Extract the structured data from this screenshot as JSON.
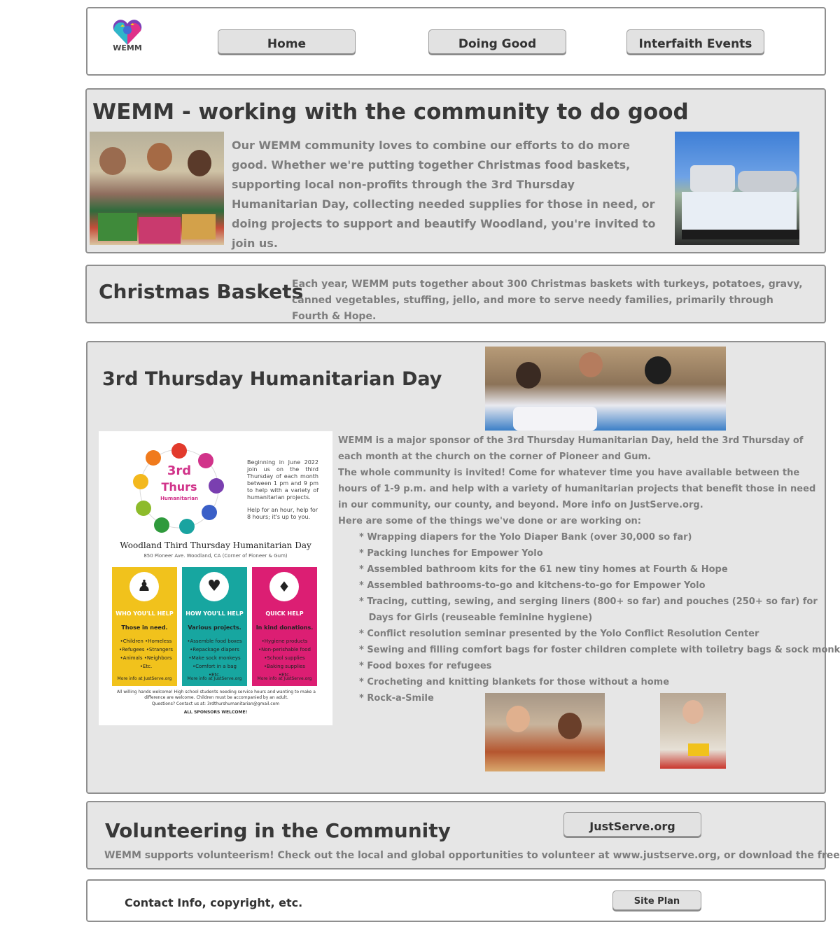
{
  "header": {
    "logo_text": "WEMM",
    "nav": [
      {
        "label": "Home"
      },
      {
        "label": "Doing Good"
      },
      {
        "label": "Interfaith Events"
      }
    ]
  },
  "intro": {
    "title": "WEMM - working with the community to do good",
    "body": "Our WEMM community loves to combine our efforts to do more good. Whether we're putting together Christmas food baskets, supporting local non-profits through the 3rd Thursday Humanitarian Day, collecting needed supplies for those in need, or doing projects to support and beautify Woodland, you're invited to join us."
  },
  "christmas": {
    "title": "Christmas Baskets",
    "body": "Each year, WEMM puts together about 300 Christmas baskets with turkeys, potatoes, gravy, canned vegetables, stuffing, jello, and more to serve needy families, primarily through Fourth & Hope."
  },
  "thursday": {
    "title": "3rd Thursday Humanitarian Day",
    "p1": "WEMM is a major sponsor of the 3rd Thursday Humanitarian Day, held the 3rd Thursday of each month at the church on the corner of Pioneer and Gum.",
    "p2": "The whole community is invited! Come for whatever time you have available between the hours of 1-9 p.m. and help with a variety of humanitarian projects that benefit those in need in our community, our county, and beyond. More info on JustServe.org.",
    "p3": "Here are some of the things we've done or are working on:",
    "items": [
      "* Wrapping diapers for the Yolo Diaper Bank (over 30,000 so far)",
      "* Packing lunches for Empower Yolo",
      "* Assembled bathroom kits for the 61 new tiny homes at Fourth & Hope",
      "* Assembled bathrooms-to-go and kitchens-to-go for Empower Yolo",
      "* Tracing, cutting, sewing, and serging liners (800+ so far) and pouches (250+ so far) for",
      "   Days for Girls (reuseable feminine hygiene)",
      "* Conflict resolution seminar presented by the Yolo Conflict Resolution Center",
      "* Sewing and filling comfort bags for foster children complete with toiletry bags & sock monkeys",
      "* Food boxes for refugees",
      "* Crocheting and knitting blankets for those without a home",
      "* Rock-a-Smile"
    ],
    "flyer": {
      "badge_top": "3rd",
      "badge_mid": "Thurs",
      "badge_arc": "Humanitarian",
      "intro": "Beginning in June 2022 join us on the third Thursday of each month between 1 pm and 9 pm to help with a variety of humanitarian projects.",
      "intro2": "Help for an hour, help for 8 hours; it's up to you.",
      "title": "Woodland Third Thursday Humanitarian Day",
      "address": "850 Pioneer Ave. Woodland, CA (Corner of Pioneer & Gum)",
      "cards": [
        {
          "heading": "WHO YOU'LL HELP",
          "sub": "Those in need.",
          "lines": [
            "•Children   •Homeless",
            "•Refugees   •Strangers",
            "•Animals   •Neighbors",
            "•Etc."
          ],
          "more": "More info at JustServe.org",
          "color": "#f1c21c"
        },
        {
          "heading": "HOW YOU'LL HELP",
          "sub": "Various projects.",
          "lines": [
            "•Assemble food boxes",
            "•Repackage diapers",
            "•Make sock monkeys",
            "•Comfort in a bag",
            "•Etc."
          ],
          "more": "More info at JustServe.org",
          "color": "#17a6a0"
        },
        {
          "heading": "QUICK HELP",
          "sub": "In kind donations.",
          "lines": [
            "•Hygiene products",
            "•Non-perishable food",
            "•School supplies",
            "•Baking supplies",
            "•Etc."
          ],
          "more": "More info at JustServe.org",
          "color": "#dc1e73"
        }
      ],
      "footer": "All willing hands welcome! High school students needing service hours and wanting to make a difference are welcome. Children must be accompanied by an adult.",
      "contact": "Questions? Contact us at: 3rdthurshumanitarian@gmail.com",
      "sponsors": "ALL SPONSORS WELCOME!"
    }
  },
  "volunteer": {
    "title": "Volunteering in the Community",
    "button": "JustServe.org",
    "body": "WEMM supports volunteerism! Check out the local and global opportunities to volunteer at www.justserve.org, or download the free app."
  },
  "footer": {
    "text": "Contact Info, copyright, etc.",
    "button": "Site Plan"
  }
}
